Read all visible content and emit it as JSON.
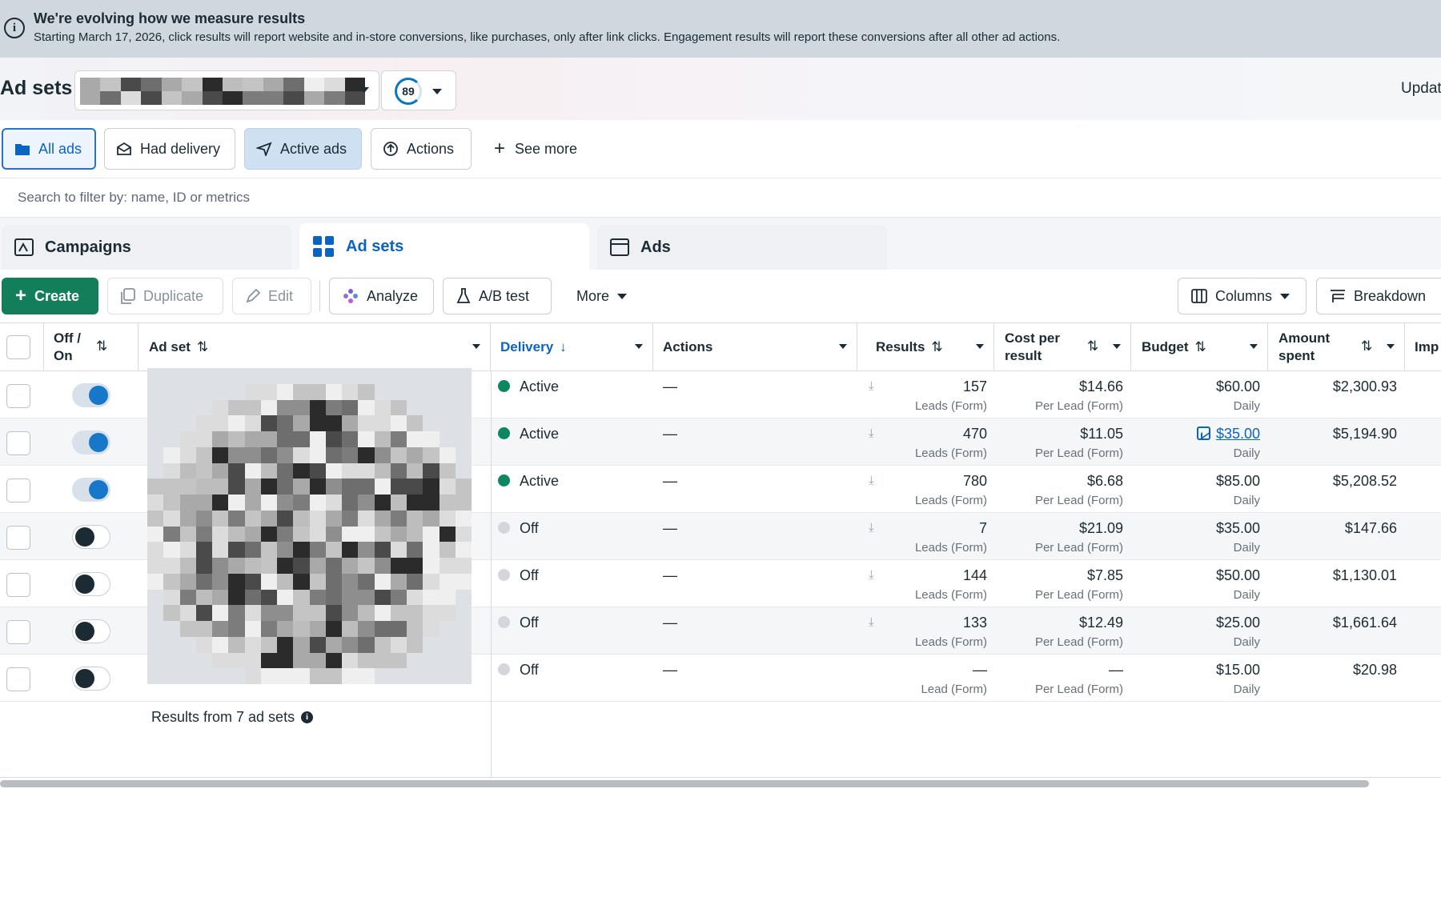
{
  "banner": {
    "title": "We're evolving how we measure results",
    "text": "Starting March 17, 2026, click results will report website and in-store conversions, like purchases, only after link clicks. Engagement results will report these conversions after all other ad actions."
  },
  "header": {
    "title": "Ad sets",
    "score": "89",
    "update_label": "Updat"
  },
  "filters": {
    "chips": [
      "All ads",
      "Had delivery",
      "Active ads",
      "Actions"
    ],
    "see_more": "See more"
  },
  "search": {
    "placeholder": "Search to filter by: name, ID or metrics"
  },
  "levels": {
    "campaigns": "Campaigns",
    "ad_sets": "Ad sets",
    "ads": "Ads"
  },
  "toolbar": {
    "create": "Create",
    "duplicate": "Duplicate",
    "edit": "Edit",
    "analyze": "Analyze",
    "ab_test": "A/B test",
    "more": "More",
    "columns": "Columns",
    "breakdown": "Breakdown"
  },
  "table": {
    "headers": {
      "off_on_1": "Off /",
      "off_on_2": "On",
      "ad_set": "Ad set",
      "delivery": "Delivery",
      "actions": "Actions",
      "results": "Results",
      "cost_1": "Cost per",
      "cost_2": "result",
      "budget": "Budget",
      "amount_1": "Amount",
      "amount_2": "spent",
      "impressions": "Imp"
    },
    "rows": [
      {
        "on": true,
        "delivery": "Active",
        "actions": "—",
        "results": "157",
        "results_sub": "Leads (Form)",
        "cost": "$14.66",
        "cost_sub": "Per Lead (Form)",
        "budget": "$60.00",
        "budget_sub": "Daily",
        "budget_link": false,
        "spent": "$2,300.93"
      },
      {
        "on": true,
        "delivery": "Active",
        "actions": "—",
        "results": "470",
        "results_sub": "Leads (Form)",
        "cost": "$11.05",
        "cost_sub": "Per Lead (Form)",
        "budget": "$35.00",
        "budget_sub": "Daily",
        "budget_link": true,
        "spent": "$5,194.90"
      },
      {
        "on": true,
        "delivery": "Active",
        "actions": "—",
        "results": "780",
        "results_sub": "Leads (Form)",
        "cost": "$6.68",
        "cost_sub": "Per Lead (Form)",
        "budget": "$85.00",
        "budget_sub": "Daily",
        "budget_link": false,
        "spent": "$5,208.52"
      },
      {
        "on": false,
        "delivery": "Off",
        "actions": "—",
        "results": "7",
        "results_sub": "Leads (Form)",
        "cost": "$21.09",
        "cost_sub": "Per Lead (Form)",
        "budget": "$35.00",
        "budget_sub": "Daily",
        "budget_link": false,
        "spent": "$147.66"
      },
      {
        "on": false,
        "delivery": "Off",
        "actions": "—",
        "results": "144",
        "results_sub": "Leads (Form)",
        "cost": "$7.85",
        "cost_sub": "Per Lead (Form)",
        "budget": "$50.00",
        "budget_sub": "Daily",
        "budget_link": false,
        "spent": "$1,130.01"
      },
      {
        "on": false,
        "delivery": "Off",
        "actions": "—",
        "results": "133",
        "results_sub": "Leads (Form)",
        "cost": "$12.49",
        "cost_sub": "Per Lead (Form)",
        "budget": "$25.00",
        "budget_sub": "Daily",
        "budget_link": false,
        "spent": "$1,661.64"
      },
      {
        "on": false,
        "delivery": "Off",
        "actions": "—",
        "results": "—",
        "results_sub": "Lead (Form)",
        "cost": "—",
        "cost_sub": "Per Lead (Form)",
        "budget": "$15.00",
        "budget_sub": "Daily",
        "budget_link": false,
        "spent": "$20.98"
      }
    ],
    "summary": "Results from 7 ad sets"
  },
  "colors": {
    "accent": "#0a64c2",
    "active_status": "#0c8760",
    "create_button": "#127f5a",
    "toggle_on": "#1877c9"
  }
}
